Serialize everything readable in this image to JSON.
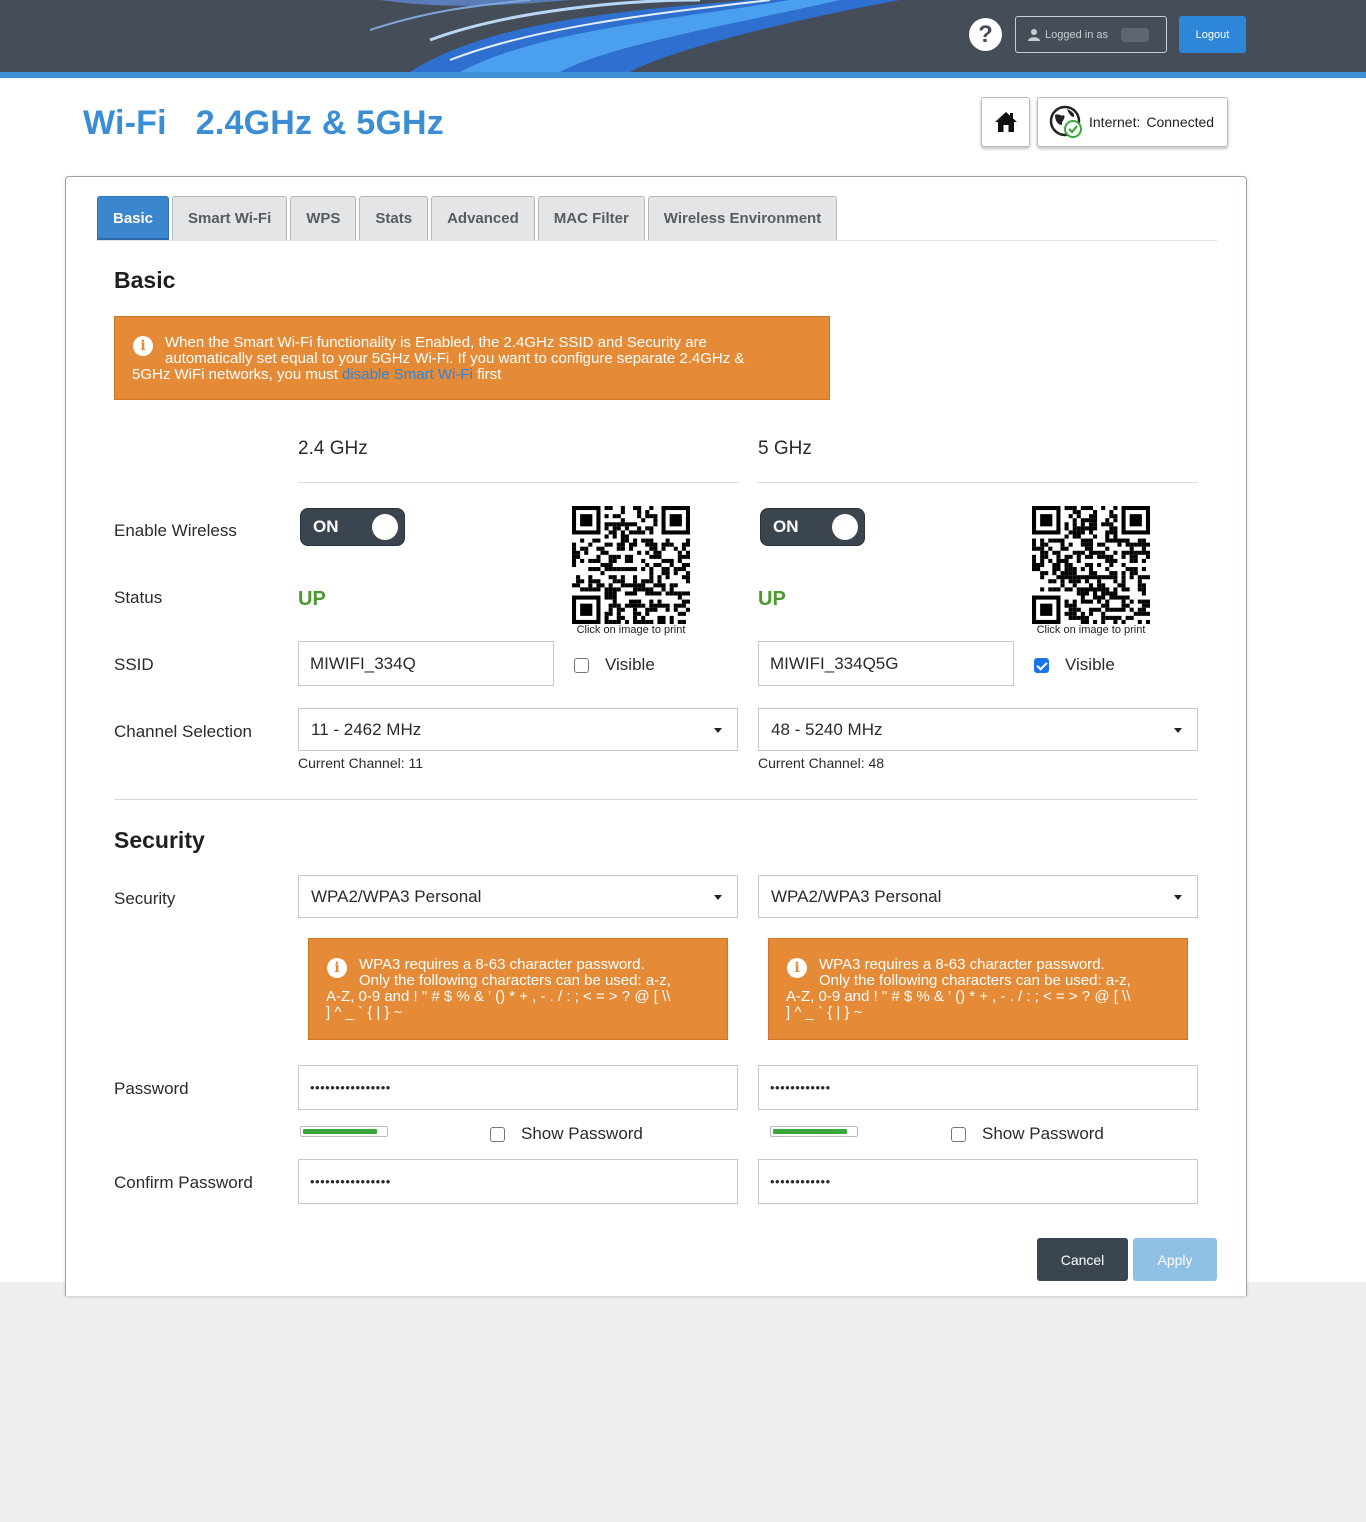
{
  "header": {
    "help_label": "?",
    "logged_in_label": "Logged in as",
    "logout_label": "Logout"
  },
  "page": {
    "title": "Wi-Fi   2.4GHz & 5GHz",
    "internet_label": "Internet:",
    "internet_status": "Connected"
  },
  "tabs": [
    {
      "label": "Basic",
      "active": true
    },
    {
      "label": "Smart Wi-Fi",
      "active": false
    },
    {
      "label": "WPS",
      "active": false
    },
    {
      "label": "Stats",
      "active": false
    },
    {
      "label": "Advanced",
      "active": false
    },
    {
      "label": "MAC Filter",
      "active": false
    },
    {
      "label": "Wireless Environment",
      "active": false
    }
  ],
  "basic": {
    "heading": "Basic",
    "alert_line1": "When the Smart Wi-Fi functionality is Enabled, the 2.4GHz SSID and Security are",
    "alert_line2": "automatically set equal to your 5GHz Wi-Fi. If you want to configure separate 2.4GHz &",
    "alert_line3_pre": "5GHz WiFi networks, you must ",
    "alert_link": "disable Smart Wi-Fi",
    "alert_line3_post": " first",
    "labels": {
      "enable_wireless": "Enable Wireless",
      "status": "Status",
      "ssid": "SSID",
      "channel_selection": "Channel Selection"
    },
    "qr_caption": "Click on image to print",
    "visible_label": "Visible",
    "bands": [
      {
        "name": "2.4 GHz",
        "toggle": "ON",
        "status": "UP",
        "ssid": "MIWIFI_334Q",
        "visible": false,
        "channel": "11 - 2462 MHz",
        "current_channel": "Current Channel: 11"
      },
      {
        "name": "5 GHz",
        "toggle": "ON",
        "status": "UP",
        "ssid": "MIWIFI_334Q5G",
        "visible": true,
        "channel": "48 - 5240 MHz",
        "current_channel": "Current Channel: 48"
      }
    ]
  },
  "security": {
    "heading": "Security",
    "labels": {
      "security": "Security",
      "password": "Password",
      "confirm_password": "Confirm Password"
    },
    "show_password_label": "Show Password",
    "warn_line1": "WPA3 requires a 8-63 character password.",
    "warn_line2": "Only the following characters can be used: a-z,",
    "warn_line3": "A-Z, 0-9 and ! \" # $ % & ' () * + , - . / : ; < = > ? @ [ \\\\",
    "warn_line4": "] ^ _ ` { | } ~",
    "bands": [
      {
        "mode": "WPA2/WPA3 Personal",
        "password": "••••••••••••••••",
        "confirm": "••••••••••••••••",
        "strength": 0.9
      },
      {
        "mode": "WPA2/WPA3 Personal",
        "password": "••••••••••••",
        "confirm": "••••••••••••",
        "strength": 0.9
      }
    ]
  },
  "actions": {
    "cancel": "Cancel",
    "apply": "Apply"
  },
  "colors": {
    "accent": "#3b8ed3",
    "alert": "#e58a37",
    "status_up": "#4b9a2e",
    "header": "#454d58"
  }
}
